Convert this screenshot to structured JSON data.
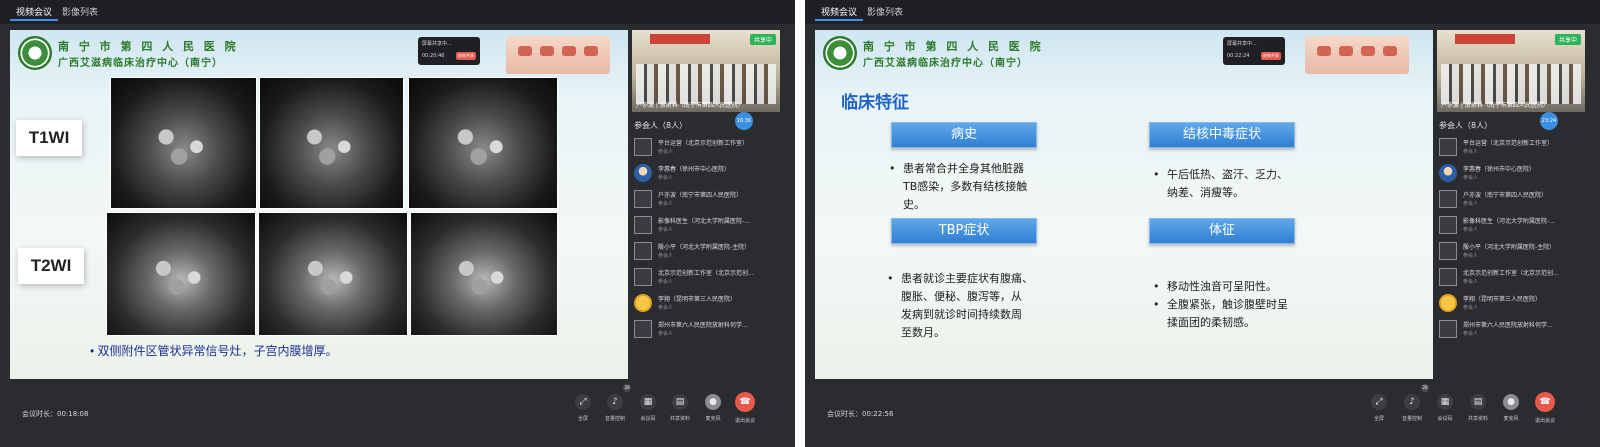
{
  "tabs": [
    "视频会议",
    "影像列表"
  ],
  "hospital": {
    "line1": "南 宁 市 第 四 人 民 医 院",
    "line2": "广西艾滋病临床治疗中心（南宁）"
  },
  "share_popup": {
    "title": "屏幕共享中...",
    "stop": "结束共享",
    "time_left": "00:20:46",
    "time_right": "00:22:24"
  },
  "left": {
    "duration": "会议时长：00:18:08",
    "t1_label": "T1WI",
    "t2_label": "T2WI",
    "caption": "• 双侧附件区管状异常信号灶，子宫内膜增厚。"
  },
  "right": {
    "duration": "会议时长：00:22:56",
    "title": "临床特征",
    "box1": "病史",
    "box2": "结核中毒症状",
    "box3": "TBP症状",
    "box4": "体征",
    "b1": [
      "患者常合并全身其他脏器",
      "TB感染，多数有结核接触",
      "史。"
    ],
    "b2": [
      "午后低热、盗汗、乏力、",
      "纳差、消瘦等。"
    ],
    "b3": [
      "患者就诊主要症状有腹痛、",
      "腹胀、便秘、腹泻等，从",
      "发病到就诊时间持续数周",
      "至数月。"
    ],
    "b4": [
      "移动性浊音可呈阳性。",
      "全腹紧张，触诊腹壁时呈",
      "揉面团的柔韧感。"
    ]
  },
  "camera": {
    "badge": "共享中",
    "name": "户亦波 | 放射科（南宁市第四人民医院）"
  },
  "timer_left": "16:36",
  "timer_right": "23:24",
  "participants_header": "参会人（8人）",
  "participants": [
    {
      "name": "平台运营（北京示范创新工作室）",
      "role": "参会人"
    },
    {
      "name": "李惠春（徐州市中心医院）",
      "role": "参会人"
    },
    {
      "name": "户亦波（南宁市第四人民医院）",
      "role": "参会人"
    },
    {
      "name": "影像科医生（河北大学附属医院-...",
      "role": "参会人"
    },
    {
      "name": "殷小平（河北大学附属医院-主院）",
      "role": "参会人"
    },
    {
      "name": "北京示范创新工作室（北京示范创...",
      "role": "参会人"
    },
    {
      "name": "李翔（昆明市第三人民医院）",
      "role": "参会人"
    },
    {
      "name": "郑州市第六人民医院放射科何学...",
      "role": "参会人"
    }
  ],
  "controls": [
    "全屏",
    "音量控制",
    "会议码",
    "共享资料",
    "麦克风",
    "退出会议"
  ],
  "volume_badge": "20"
}
